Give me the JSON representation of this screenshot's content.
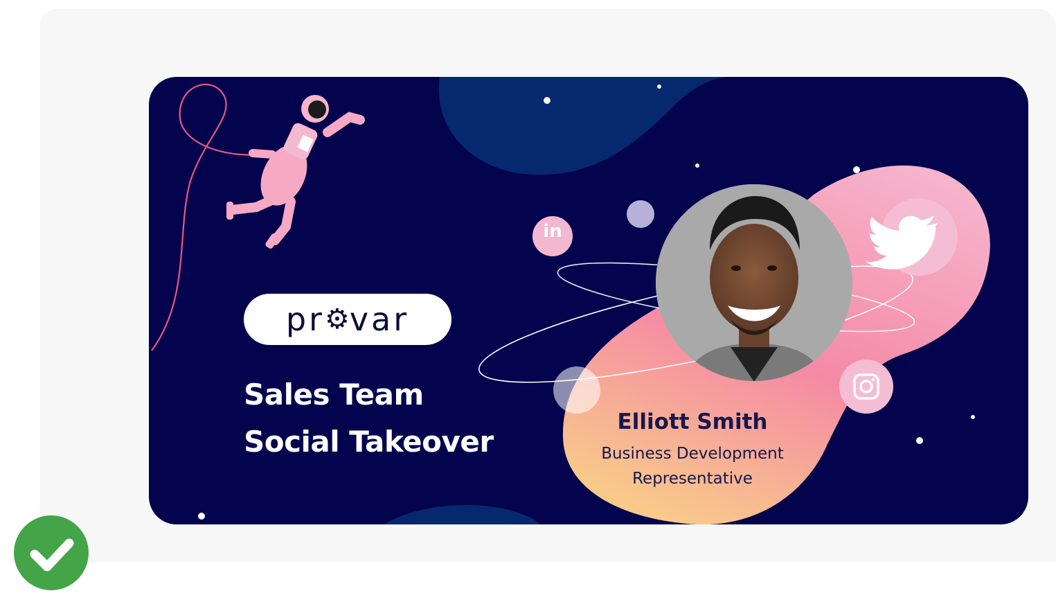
{
  "banner": {
    "logo_text": "pr⚙var",
    "logo_before": "pr",
    "logo_after": "var",
    "headline_line1": "Sales Team",
    "headline_line2": "Social Takeover",
    "person_name": "Elliott Smith",
    "person_role_line1": "Business Development",
    "person_role_line2": "Representative",
    "social_icons": [
      "linkedin-icon",
      "twitter-icon",
      "instagram-icon"
    ],
    "linkedin_label": "in"
  },
  "colors": {
    "background": "#03034e",
    "blob_blue": "#0a2a70",
    "blob_pink": "#f58aa8",
    "blob_peach": "#f7c58a",
    "check_green": "#43a547"
  },
  "status_icon": "check-circle-icon"
}
